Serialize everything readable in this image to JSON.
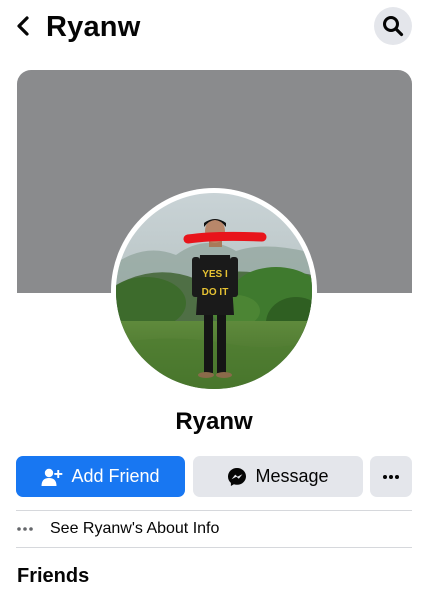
{
  "header": {
    "title": "Ryanw",
    "back_icon": "chevron-left-icon",
    "search_icon": "search-icon"
  },
  "profile": {
    "name": "Ryanw",
    "cover_color": "#8a8b8d",
    "shirt_text": "YES I DO IT"
  },
  "actions": {
    "add_friend_label": "Add Friend",
    "message_label": "Message",
    "more_icon": "more-horizontal-icon"
  },
  "about": {
    "label": "See Ryanw's About Info"
  },
  "sections": {
    "friends_title": "Friends"
  },
  "colors": {
    "primary": "#1877f2",
    "button_gray": "#e4e6eb",
    "text": "#050505",
    "redaction": "#e8141b"
  }
}
